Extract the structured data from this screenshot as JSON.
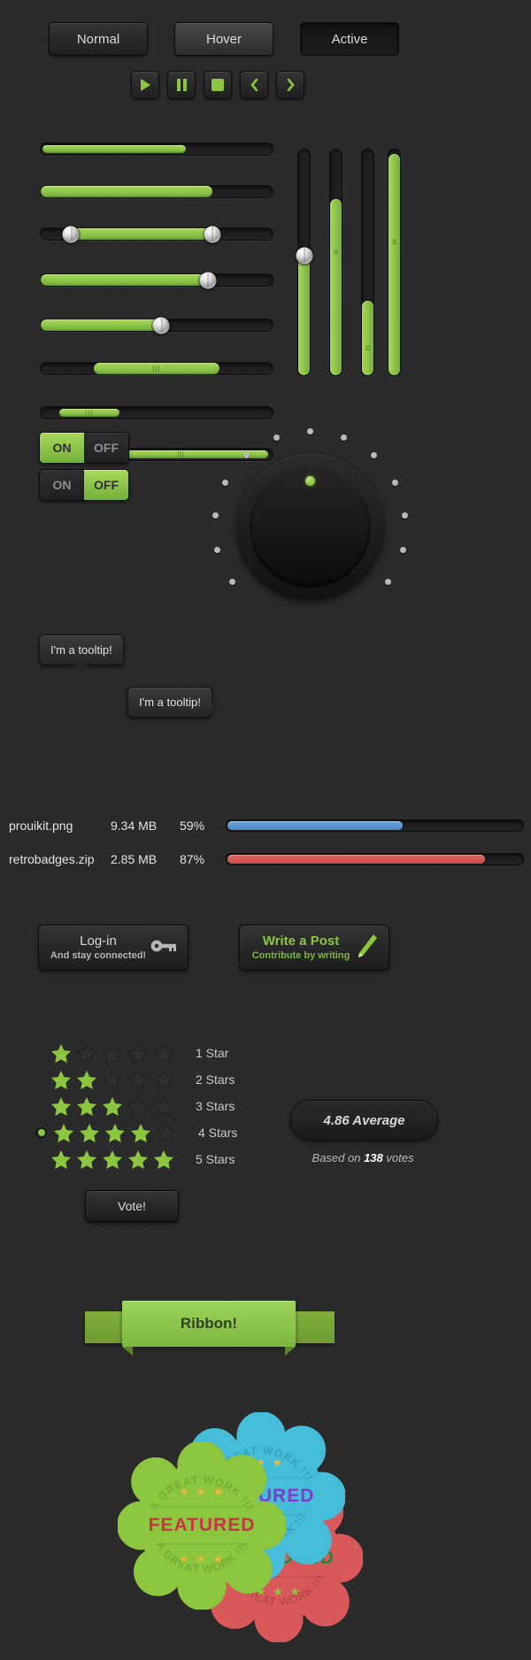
{
  "theme": {
    "bg": "#292929",
    "green": "#8cc63f",
    "green_light": "#a8d95a",
    "green_dark": "#74b03a",
    "blue": "#5b9bd5",
    "red": "#d9534f"
  },
  "state_buttons": [
    {
      "label": "Normal",
      "state": "normal"
    },
    {
      "label": "Hover",
      "state": "hover"
    },
    {
      "label": "Active",
      "state": "active"
    }
  ],
  "media_buttons": [
    {
      "icon": "play-icon",
      "label": "Play"
    },
    {
      "icon": "pause-icon",
      "label": "Pause"
    },
    {
      "icon": "stop-icon",
      "label": "Stop"
    },
    {
      "icon": "previous-icon",
      "label": "Previous"
    },
    {
      "icon": "next-icon",
      "label": "Next"
    }
  ],
  "horizontal_sliders": [
    {
      "name": "progress-thin-1",
      "percent": 62,
      "style": "thin",
      "handle": "none",
      "grip": false
    },
    {
      "name": "progress-thick-1",
      "percent": 74,
      "style": "thick",
      "handle": "none",
      "grip": false
    },
    {
      "name": "range-slider",
      "percent": 74,
      "start": 13,
      "style": "thick",
      "handle": "both",
      "grip": false
    },
    {
      "name": "slider-handle-1",
      "percent": 73,
      "style": "thick",
      "handle": "right",
      "grip": false
    },
    {
      "name": "slider-handle-2",
      "percent": 53,
      "style": "thick",
      "handle": "right",
      "grip": false
    },
    {
      "name": "grip-slider-1",
      "percent": 54,
      "start": 23,
      "style": "thick",
      "handle": "none",
      "grip": true
    },
    {
      "name": "grip-slider-2",
      "percent": 26,
      "start": 8,
      "style": "thin",
      "handle": "none",
      "grip": true
    },
    {
      "name": "grip-slider-3",
      "percent": 75,
      "start": 23,
      "style": "thin",
      "handle": "none",
      "grip": true
    }
  ],
  "vertical_sliders": [
    {
      "name": "v-slider-1",
      "percent": 53,
      "handle": "top",
      "grip": false
    },
    {
      "name": "v-slider-2",
      "percent": 78,
      "handle": "none",
      "grip": true
    },
    {
      "name": "v-slider-3",
      "percent": 33,
      "handle": "none",
      "grip": true
    },
    {
      "name": "v-slider-4",
      "percent": 98,
      "handle": "none",
      "grip": true
    }
  ],
  "toggles": [
    {
      "name": "toggle-on",
      "on_label": "ON",
      "off_label": "OFF",
      "value": "ON"
    },
    {
      "name": "toggle-off",
      "on_label": "ON",
      "off_label": "OFF",
      "value": "OFF"
    }
  ],
  "tooltips": [
    {
      "name": "tooltip-bottom-arrow",
      "text": "I'm a tooltip!",
      "arrow": "down"
    },
    {
      "name": "tooltip-right-arrow",
      "text": "I'm a tooltip!",
      "arrow": "right"
    }
  ],
  "knob": {
    "name": "rotary-knob",
    "indicator_color": "#8cc63f",
    "tick_count": 13
  },
  "downloads": {
    "rows": [
      {
        "filename": "prouikit.png",
        "size": "9.34 MB",
        "percent_label": "59%",
        "percent": 59,
        "color": "#5b9bd5"
      },
      {
        "filename": "retrobadges.zip",
        "size": "2.85 MB",
        "percent_label": "87%",
        "percent": 87,
        "color": "#d9534f"
      }
    ]
  },
  "action_buttons": [
    {
      "name": "login-button",
      "title": "Log-in",
      "subtitle": "And stay connected!",
      "icon": "key-icon",
      "style": "grey"
    },
    {
      "name": "write-post-button",
      "title": "Write a Post",
      "subtitle": "Contribute by writing",
      "icon": "pencil-icon",
      "style": "green"
    }
  ],
  "rating": {
    "rows": [
      {
        "name": "rating-row-1",
        "filled": 1,
        "total": 5,
        "label": "1 Star",
        "selected": false
      },
      {
        "name": "rating-row-2",
        "filled": 2,
        "total": 5,
        "label": "2 Stars",
        "selected": false
      },
      {
        "name": "rating-row-3",
        "filled": 3,
        "total": 5,
        "label": "3 Stars",
        "selected": false
      },
      {
        "name": "rating-row-4",
        "filled": 4,
        "total": 5,
        "label": "4 Stars",
        "selected": true
      },
      {
        "name": "rating-row-5",
        "filled": 5,
        "total": 5,
        "label": "5 Stars",
        "selected": false
      }
    ],
    "vote_button_label": "Vote!",
    "average_label": "4.86 Average",
    "based_on_prefix": "Based on ",
    "based_on_count": "138",
    "based_on_suffix": " votes"
  },
  "ribbon": {
    "name": "ribbon-banner",
    "label": "Ribbon!"
  },
  "badges": [
    {
      "name": "badge-red",
      "main_text": "APPROVED",
      "arc_top": "A GREAT WORK !!!",
      "arc_bottom": "A GREAT WORK !!!",
      "ministars": "★ ★ ★",
      "fill": "#d9595a",
      "fill_dark": "#c24a4b",
      "text_color": "#1b8a3b",
      "star_color": "#8cc63f",
      "arc_color": "#b94849"
    },
    {
      "name": "badge-blue",
      "main_text": "FEATURED",
      "arc_top": "A GREAT WORK !!!",
      "arc_bottom": "A GREAT WORK !!!",
      "ministars": "★ ★ ★",
      "fill": "#45bcd8",
      "fill_dark": "#36a7c2",
      "text_color": "#7b3fd0",
      "star_color": "#e8b93c",
      "arc_color": "#3aa3bd"
    },
    {
      "name": "badge-green",
      "main_text": "FEATURED",
      "arc_top": "A GREAT WORK !!!",
      "arc_bottom": "A GREAT WORK !!!",
      "ministars": "★ ★ ★",
      "fill": "#8cc63f",
      "fill_dark": "#7ab233",
      "text_color": "#cc3344",
      "star_color": "#e8b93c",
      "arc_color": "#79ad36"
    }
  ]
}
